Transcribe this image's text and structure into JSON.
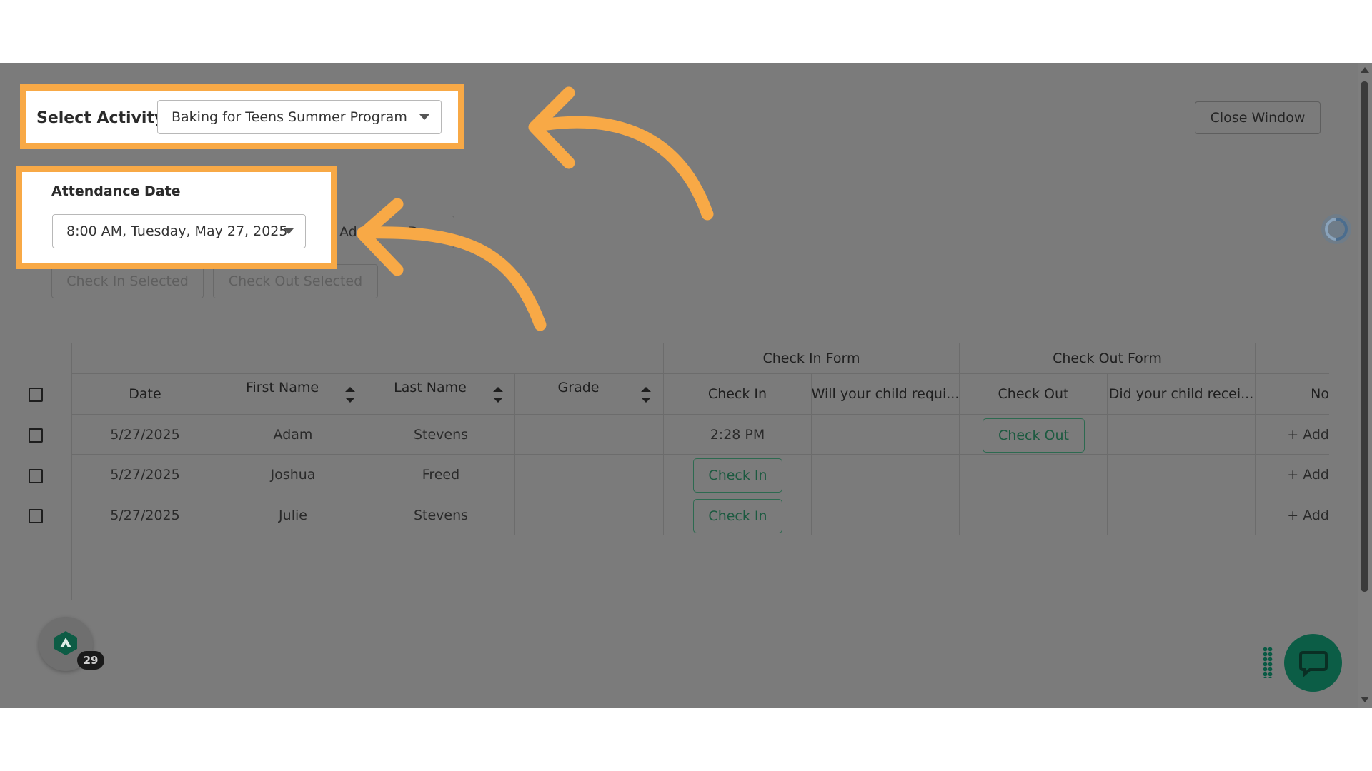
{
  "activity": {
    "label": "Select Activity:",
    "value": "Baking for Teens Summer Program"
  },
  "close_window_label": "Close Window",
  "attendance": {
    "label": "Attendance Date",
    "value": "8:00 AM, Tuesday, May 27, 2025"
  },
  "add_date_label": "Ad",
  "add_date_tail": "Da",
  "check_in_selected_label": "Check In Selected",
  "check_out_selected_label": "Check Out Selected",
  "table": {
    "group_headers": {
      "check_in_form": "Check In Form",
      "check_out_form": "Check Out Form"
    },
    "columns": {
      "date": "Date",
      "first_name": "First Name",
      "last_name": "Last Name",
      "grade": "Grade",
      "check_in": "Check In",
      "will_require": "Will your child requi...",
      "check_out": "Check Out",
      "did_receive": "Did your child recei...",
      "notes": "No"
    },
    "rows": [
      {
        "date": "5/27/2025",
        "first_name": "Adam",
        "last_name": "Stevens",
        "grade": "",
        "check_in": "2:28 PM",
        "check_out_button": "Check Out",
        "notes_action": "+ Add"
      },
      {
        "date": "5/27/2025",
        "first_name": "Joshua",
        "last_name": "Freed",
        "grade": "",
        "check_in_button": "Check In",
        "notes_action": "+ Add"
      },
      {
        "date": "5/27/2025",
        "first_name": "Julie",
        "last_name": "Stevens",
        "grade": "",
        "check_in_button": "Check In",
        "notes_action": "+ Add"
      }
    ]
  },
  "notification_badge_count": "29",
  "colors": {
    "overlay": "#7b7b7b",
    "highlight": "#f8a946",
    "accent_green": "#0e6e52"
  }
}
